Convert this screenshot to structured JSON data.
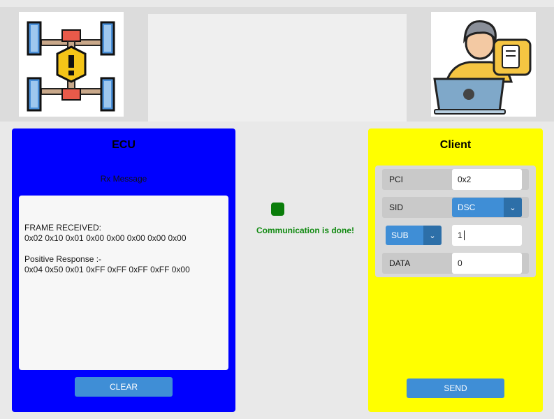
{
  "ecu": {
    "title": "ECU",
    "rx_label": "Rx Message",
    "log": {
      "frame_header": "FRAME RECEIVED:",
      "frame_bytes": "0x02 0x10 0x01 0x00 0x00 0x00 0x00 0x00",
      "response_header": "Positive Response :-",
      "response_bytes": "0x04 0x50 0x01 0xFF 0xFF 0xFF 0xFF 0x00"
    },
    "clear_label": "CLEAR"
  },
  "status": {
    "indicator_color": "#0a7d0a",
    "text": "Communication is done!"
  },
  "client": {
    "title": "Client",
    "pci": {
      "label": "PCI",
      "value": "0x2"
    },
    "sid": {
      "label": "SID",
      "selected": "DSC"
    },
    "sub": {
      "selected": "SUB",
      "value": "1"
    },
    "data": {
      "label": "DATA",
      "value": "0"
    },
    "send_label": "SEND"
  },
  "colors": {
    "ecu_panel": "#0000ff",
    "client_panel": "#ffff00",
    "button": "#3f8ed6",
    "status_text": "#118a11"
  }
}
